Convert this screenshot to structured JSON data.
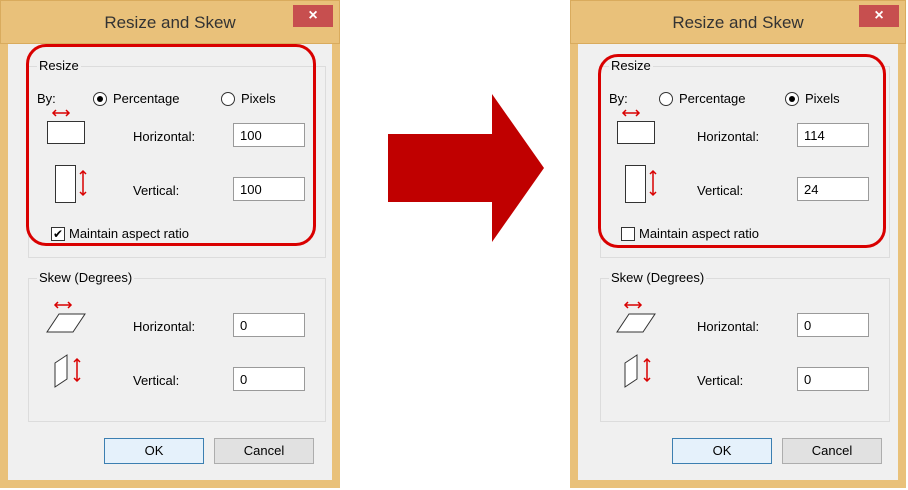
{
  "arrow": {
    "color": "#c00000",
    "icon": "right-arrow-icon"
  },
  "dialogs": [
    {
      "title": "Resize and Skew",
      "close_label": "×",
      "resize": {
        "group_label": "Resize",
        "by_label": "By:",
        "percentage_label": "Percentage",
        "pixels_label": "Pixels",
        "selected_unit": "Percentage",
        "horizontal_label": "Horizontal:",
        "horizontal_value": "100",
        "vertical_label": "Vertical:",
        "vertical_value": "100",
        "maintain_label": "Maintain aspect ratio",
        "maintain_checked": true,
        "check_mark": "✔"
      },
      "skew": {
        "group_label": "Skew (Degrees)",
        "horizontal_label": "Horizontal:",
        "horizontal_value": "0",
        "vertical_label": "Vertical:",
        "vertical_value": "0"
      },
      "ok_label": "OK",
      "cancel_label": "Cancel"
    },
    {
      "title": "Resize and Skew",
      "close_label": "×",
      "resize": {
        "group_label": "Resize",
        "by_label": "By:",
        "percentage_label": "Percentage",
        "pixels_label": "Pixels",
        "selected_unit": "Pixels",
        "horizontal_label": "Horizontal:",
        "horizontal_value": "114",
        "vertical_label": "Vertical:",
        "vertical_value": "24",
        "maintain_label": "Maintain aspect ratio",
        "maintain_checked": false,
        "check_mark": ""
      },
      "skew": {
        "group_label": "Skew (Degrees)",
        "horizontal_label": "Horizontal:",
        "horizontal_value": "0",
        "vertical_label": "Vertical:",
        "vertical_value": "0"
      },
      "ok_label": "OK",
      "cancel_label": "Cancel"
    }
  ],
  "colors": {
    "title_bar": "#e9c17a",
    "highlight": "#d90000",
    "close": "#c74f4f"
  }
}
